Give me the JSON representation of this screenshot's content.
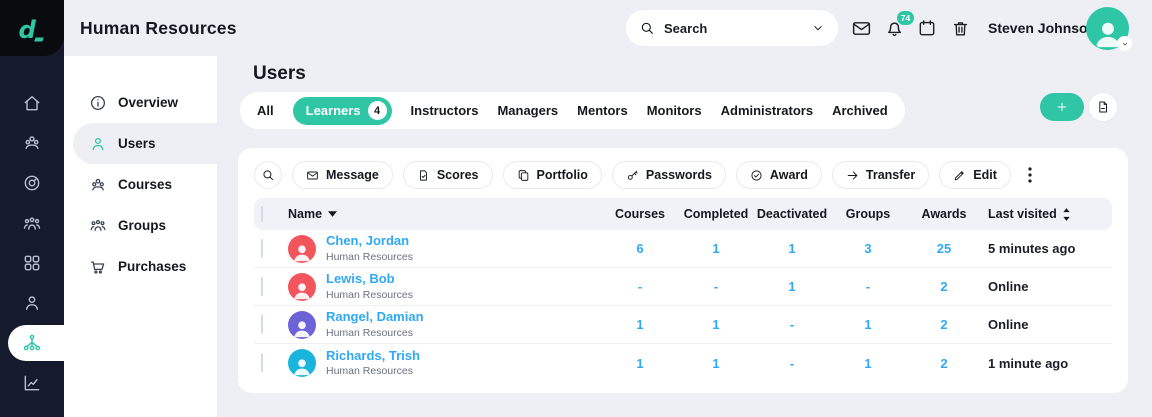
{
  "colors": {
    "accent_green": "#2FC6A5",
    "link_blue": "#2FA9F5",
    "rail_navy": "#151B2D",
    "page_bg": "#EDEFF4",
    "user_avatar": "#2FC6A5"
  },
  "topbar": {
    "title": "Human Resources",
    "search_placeholder": "Search",
    "notifications_badge": "74",
    "user_name": "Steven Johnson",
    "icons": [
      "envelope-icon",
      "bell-icon",
      "calendar-icon",
      "trash-icon"
    ]
  },
  "rail": {
    "icons": [
      "home-icon",
      "courses-icon",
      "dashboard-icon",
      "people-icon",
      "apps-icon",
      "profile-icon",
      "organization-icon",
      "reports-icon"
    ],
    "active": "organization-icon"
  },
  "sidebar": {
    "items": [
      {
        "label": "Overview",
        "icon": "info-circle-icon"
      },
      {
        "label": "Users",
        "icon": "user-icon",
        "active": true
      },
      {
        "label": "Courses",
        "icon": "group-icon"
      },
      {
        "label": "Groups",
        "icon": "people-icon"
      },
      {
        "label": "Purchases",
        "icon": "cart-icon"
      }
    ]
  },
  "users_page": {
    "title": "Users",
    "tabs": [
      {
        "label": "All"
      },
      {
        "label": "Learners",
        "count": "4",
        "active": true
      },
      {
        "label": "Instructors"
      },
      {
        "label": "Managers"
      },
      {
        "label": "Mentors"
      },
      {
        "label": "Monitors"
      },
      {
        "label": "Administrators"
      },
      {
        "label": "Archived"
      }
    ],
    "actions": {
      "add": "plus-icon",
      "export": "file-export-icon"
    },
    "toolbar": {
      "buttons": [
        {
          "label": "Message",
          "icon": "envelope-icon"
        },
        {
          "label": "Scores",
          "icon": "file-check-icon"
        },
        {
          "label": "Portfolio",
          "icon": "copy-icon"
        },
        {
          "label": "Passwords",
          "icon": "key-icon"
        },
        {
          "label": "Award",
          "icon": "check-circle-icon"
        },
        {
          "label": "Transfer",
          "icon": "arrow-right-icon"
        },
        {
          "label": "Edit",
          "icon": "pencil-icon"
        }
      ],
      "more": "kebab-icon"
    },
    "table": {
      "columns": {
        "name": "Name",
        "courses": "Courses",
        "completed": "Completed",
        "deactivated": "Deactivated",
        "groups": "Groups",
        "awards": "Awards",
        "last_visited": "Last visited"
      },
      "rows": [
        {
          "name": "Chen, Jordan",
          "subtitle": "Human Resources",
          "courses": "6",
          "completed": "1",
          "deactivated": "1",
          "groups": "3",
          "awards": "25",
          "last_visited": "5 minutes ago",
          "avatar_color": "#F2555C"
        },
        {
          "name": "Lewis, Bob",
          "subtitle": "Human Resources",
          "courses": "-",
          "completed": "-",
          "deactivated": "1",
          "groups": "-",
          "awards": "2",
          "last_visited": "Online",
          "avatar_color": "#F2555C"
        },
        {
          "name": "Rangel, Damian",
          "subtitle": "Human Resources",
          "courses": "1",
          "completed": "1",
          "deactivated": "-",
          "groups": "1",
          "awards": "2",
          "last_visited": "Online",
          "avatar_color": "#6E62D9"
        },
        {
          "name": "Richards, Trish",
          "subtitle": "Human Resources",
          "courses": "1",
          "completed": "1",
          "deactivated": "-",
          "groups": "1",
          "awards": "2",
          "last_visited": "1 minute ago",
          "avatar_color": "#1AB5DC"
        }
      ]
    }
  }
}
